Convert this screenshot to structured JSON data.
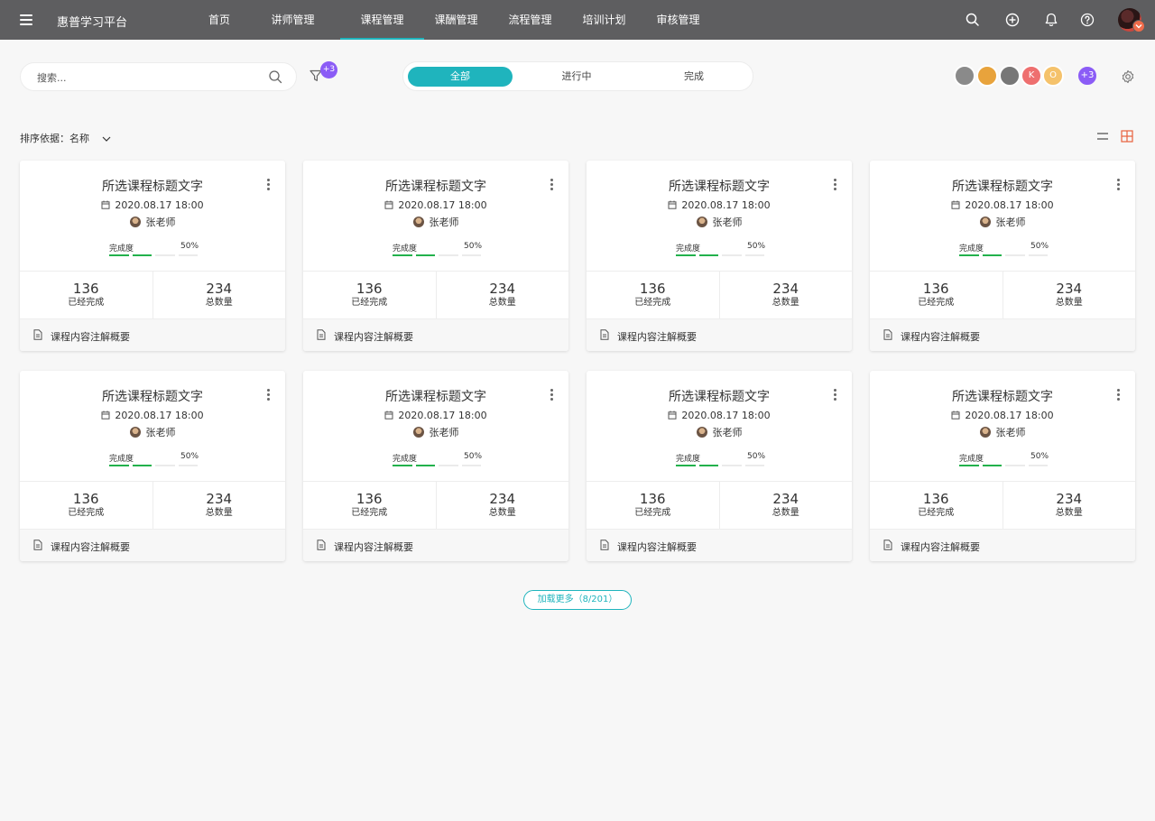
{
  "app": {
    "title": "惠普学习平台"
  },
  "nav": {
    "tabs": [
      {
        "label": "首页",
        "active": false
      },
      {
        "label": "讲师管理",
        "active": false
      },
      {
        "label": "课程管理",
        "active": true
      },
      {
        "label": "课酬管理",
        "active": false
      },
      {
        "label": "流程管理",
        "active": false
      },
      {
        "label": "培训计划",
        "active": false
      },
      {
        "label": "审核管理",
        "active": false
      }
    ]
  },
  "topbar_icons": [
    "search-icon",
    "add-icon",
    "bell-icon",
    "help-icon"
  ],
  "search": {
    "placeholder": "搜索...",
    "value": ""
  },
  "filter": {
    "badge": "+3"
  },
  "status_tabs": [
    {
      "label": "全部",
      "active": true
    },
    {
      "label": "进行中",
      "active": false
    },
    {
      "label": "完成",
      "active": false
    }
  ],
  "team": {
    "members": [
      {
        "initial": "",
        "color": "#8a8a8a"
      },
      {
        "initial": "",
        "color": "#e8a33c"
      },
      {
        "initial": "",
        "color": "#777777"
      },
      {
        "initial": "K",
        "color": "#ee6f6f"
      },
      {
        "initial": "O",
        "color": "#f5c26b"
      }
    ],
    "more": "+3"
  },
  "sort": {
    "label": "排序依据：",
    "value": "名称"
  },
  "cards": [
    {
      "title": "所选课程标题文字",
      "date": "2020.08.17 18:00",
      "teacher": "张老师",
      "progress_label": "完成度",
      "progress": 50,
      "progress_text": "50%",
      "completed": "136",
      "completed_label": "已经完成",
      "total": "234",
      "total_label": "总数量",
      "note": "课程内容注解概要"
    },
    {
      "title": "所选课程标题文字",
      "date": "2020.08.17 18:00",
      "teacher": "张老师",
      "progress_label": "完成度",
      "progress": 50,
      "progress_text": "50%",
      "completed": "136",
      "completed_label": "已经完成",
      "total": "234",
      "total_label": "总数量",
      "note": "课程内容注解概要"
    },
    {
      "title": "所选课程标题文字",
      "date": "2020.08.17 18:00",
      "teacher": "张老师",
      "progress_label": "完成度",
      "progress": 50,
      "progress_text": "50%",
      "completed": "136",
      "completed_label": "已经完成",
      "total": "234",
      "total_label": "总数量",
      "note": "课程内容注解概要"
    },
    {
      "title": "所选课程标题文字",
      "date": "2020.08.17 18:00",
      "teacher": "张老师",
      "progress_label": "完成度",
      "progress": 50,
      "progress_text": "50%",
      "completed": "136",
      "completed_label": "已经完成",
      "total": "234",
      "total_label": "总数量",
      "note": "课程内容注解概要"
    },
    {
      "title": "所选课程标题文字",
      "date": "2020.08.17 18:00",
      "teacher": "张老师",
      "progress_label": "完成度",
      "progress": 50,
      "progress_text": "50%",
      "completed": "136",
      "completed_label": "已经完成",
      "total": "234",
      "total_label": "总数量",
      "note": "课程内容注解概要"
    },
    {
      "title": "所选课程标题文字",
      "date": "2020.08.17 18:00",
      "teacher": "张老师",
      "progress_label": "完成度",
      "progress": 50,
      "progress_text": "50%",
      "completed": "136",
      "completed_label": "已经完成",
      "total": "234",
      "total_label": "总数量",
      "note": "课程内容注解概要"
    },
    {
      "title": "所选课程标题文字",
      "date": "2020.08.17 18:00",
      "teacher": "张老师",
      "progress_label": "完成度",
      "progress": 50,
      "progress_text": "50%",
      "completed": "136",
      "completed_label": "已经完成",
      "total": "234",
      "total_label": "总数量",
      "note": "课程内容注解概要"
    },
    {
      "title": "所选课程标题文字",
      "date": "2020.08.17 18:00",
      "teacher": "张老师",
      "progress_label": "完成度",
      "progress": 50,
      "progress_text": "50%",
      "completed": "136",
      "completed_label": "已经完成",
      "total": "234",
      "total_label": "总数量",
      "note": "课程内容注解概要"
    }
  ],
  "load_more": {
    "label": "加载更多（8/201）"
  },
  "colors": {
    "topbar": "#5e5e60",
    "accent": "#1fb4bd",
    "progress": "#22b14c",
    "badge": "#8b5cf6",
    "view_active": "#e8603c"
  }
}
